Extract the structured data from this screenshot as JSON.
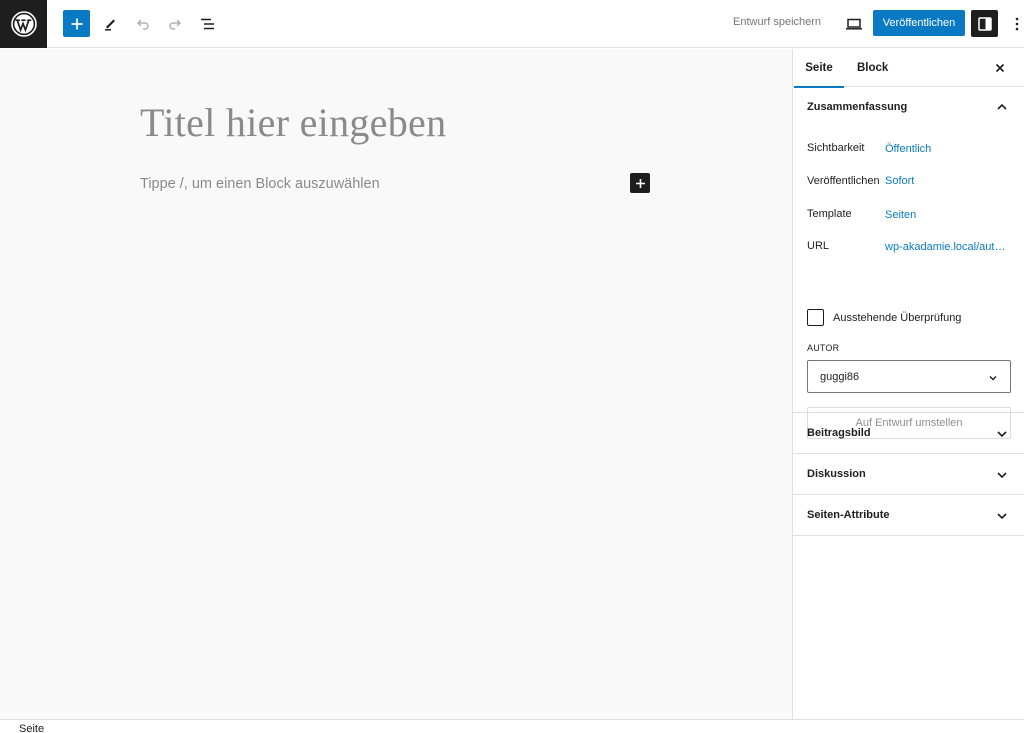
{
  "header": {
    "save_draft": "Entwurf speichern",
    "publish": "Veröffentlichen"
  },
  "editor": {
    "title_placeholder": "Titel hier eingeben",
    "block_placeholder": "Tippe /, um einen Block auszuwählen"
  },
  "sidebar": {
    "tabs": [
      "Seite",
      "Block"
    ],
    "summary": {
      "title": "Zusammenfassung",
      "rows": [
        {
          "label": "Sichtbarkeit",
          "value": "Öffentlich"
        },
        {
          "label": "Veröffentlichen",
          "value": "Sofort"
        },
        {
          "label": "Template",
          "value": "Seiten"
        },
        {
          "label": "URL",
          "value": "wp-akadamie.local/aut…"
        }
      ],
      "pending_review": "Ausstehende Überprüfung",
      "author_label": "AUTOR",
      "author_value": "guggi86",
      "switch_to_draft": "Auf Entwurf umstellen"
    },
    "panels": [
      "Beitragsbild",
      "Diskussion",
      "Seiten-Attribute"
    ]
  },
  "status_bar": {
    "breadcrumb": "Seite"
  },
  "colors": {
    "accent": "#0a79c3",
    "dark": "#1e1e1e"
  }
}
